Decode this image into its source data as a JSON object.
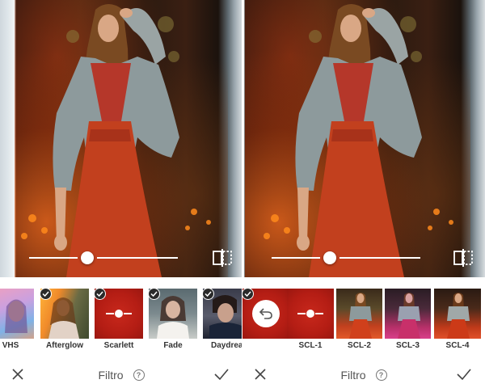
{
  "left_panel": {
    "bottom_bar": {
      "title": "Filtro",
      "help": "?"
    },
    "filters": [
      {
        "label": "VHS",
        "selected": false
      },
      {
        "label": "Afterglow",
        "selected": true
      },
      {
        "label": "Scarlett",
        "selected": true
      },
      {
        "label": "Fade",
        "selected": true
      },
      {
        "label": "Daydream",
        "selected": true
      }
    ],
    "active_filter": "Scarlett",
    "slider_value": 0.5
  },
  "right_panel": {
    "bottom_bar": {
      "title": "Filtro",
      "help": "?"
    },
    "filters": [
      {
        "label": "",
        "type": "undo",
        "selected": true
      },
      {
        "label": "SCL-1",
        "selected": false
      },
      {
        "label": "SCL-2",
        "selected": false
      },
      {
        "label": "SCL-3",
        "selected": false
      },
      {
        "label": "SCL-4",
        "selected": false
      }
    ],
    "active_filter": "SCL-1",
    "slider_value": 0.5
  },
  "icons": {
    "cancel": "close-icon",
    "confirm": "checkmark-icon",
    "compare": "compare-split-icon",
    "undo": "undo-arrow-icon",
    "adjust": "slider-adjust-icon",
    "selected": "checkmark-badge-icon",
    "help": "help-circle-icon"
  },
  "colors": {
    "scarlett_red": "#c0201a",
    "check_badge": "#2a2a2a",
    "label_text": "#333333",
    "bar_text": "#555555"
  }
}
